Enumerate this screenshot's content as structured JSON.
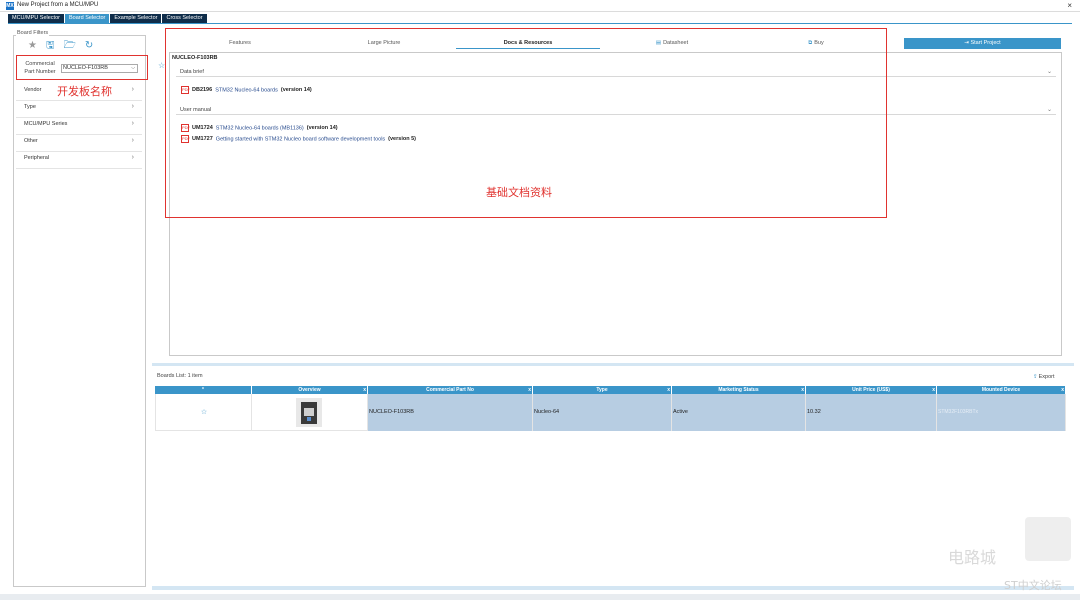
{
  "window": {
    "title": "New Project from a MCU/MPU",
    "icon_text": "MX",
    "close": "×"
  },
  "tabs": [
    "MCU/MPU Selector",
    "Board Selector",
    "Example Selector",
    "Cross Selector"
  ],
  "sidebar": {
    "title": "Board Filters",
    "icons": [
      "star-icon",
      "save-icon",
      "folder-open-icon",
      "reset-icon"
    ],
    "cpn_label": "Commercial Part Number",
    "cpn_value": "NUCLEO-F103RB",
    "categories": [
      "Vendor",
      "Type",
      "MCU/MPU Series",
      "Other",
      "Peripheral"
    ]
  },
  "annotations": {
    "left": "开发板名称",
    "main": "基础文档资料"
  },
  "main": {
    "sub_tabs": [
      "Features",
      "Large Picture",
      "Docs & Resources",
      "Datasheet",
      "Buy"
    ],
    "start_project": "Start Project",
    "board_name": "NUCLEO-F103RB",
    "sections": [
      {
        "title": "Data brief",
        "docs": [
          {
            "code": "DB2196",
            "title": "STM32 Nucleo-64 boards",
            "version": "(version 14)"
          }
        ]
      },
      {
        "title": "User manual",
        "docs": [
          {
            "code": "UM1724",
            "title": "STM32 Nucleo-64 boards (MB1136)",
            "version": "(version 14)"
          },
          {
            "code": "UM1727",
            "title": "Getting started with STM32 Nucleo board software development tools",
            "version": "(version 5)"
          }
        ]
      }
    ]
  },
  "boards_list": {
    "label": "Boards List: 1 item",
    "export": "Export",
    "columns": [
      "*",
      "Overview",
      "Commercial Part No",
      "Type",
      "Marketing Status",
      "Unit Price (US$)",
      "Mounted Device"
    ],
    "rows": [
      {
        "part": "NUCLEO-F103RB",
        "type": "Nucleo-64",
        "status": "Active",
        "price": "10.32",
        "device": "STM32F103RBTx"
      }
    ]
  },
  "watermark": {
    "main": "电路城",
    "sub": "ST中文论坛"
  },
  "colors": {
    "accent": "#3a95c9",
    "dark_tab": "#0f2d4a",
    "annotation": "#e0332f",
    "selected_row": "#b7cde2"
  }
}
